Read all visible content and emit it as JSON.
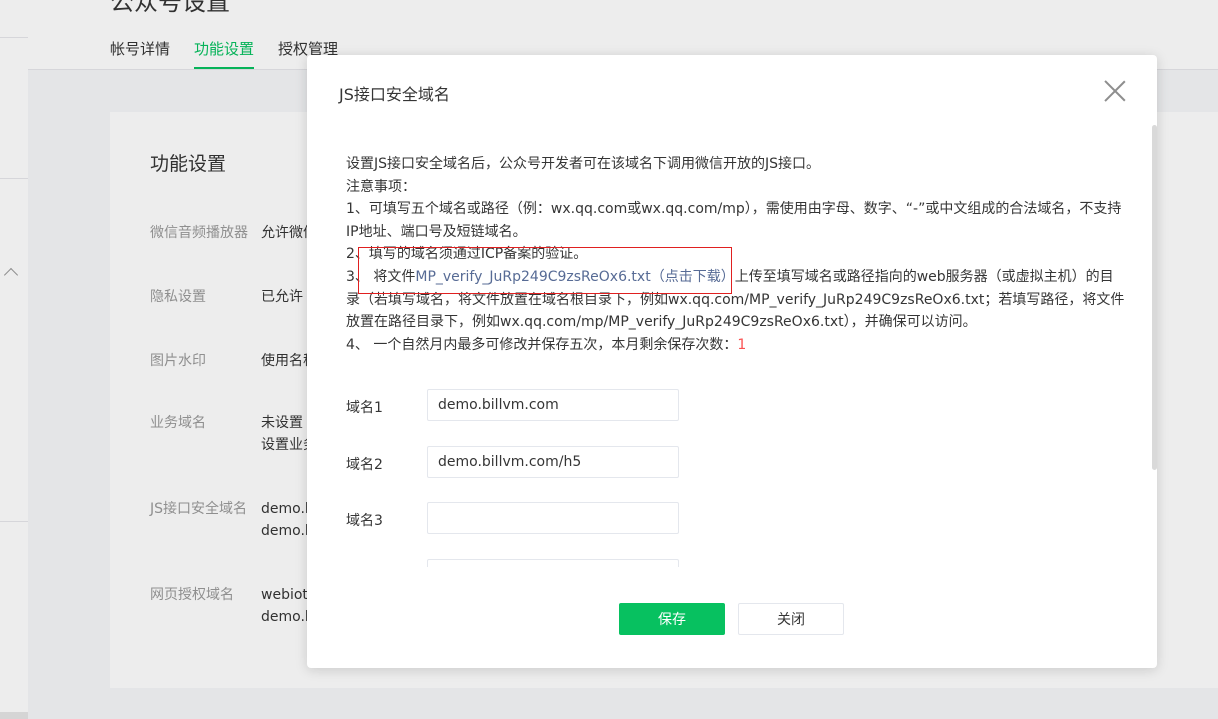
{
  "page": {
    "title": "公众号设置",
    "tabs": [
      {
        "label": "帐号详情"
      },
      {
        "label": "功能设置"
      },
      {
        "label": "授权管理"
      }
    ],
    "card_title": "功能设置",
    "settings": [
      {
        "label": "微信音频播放器",
        "value": "允许微信"
      },
      {
        "label": "隐私设置",
        "value": "已允许"
      },
      {
        "label": "图片水印",
        "value": "使用名称"
      },
      {
        "label": "业务域名",
        "value": "未设置",
        "value2": "设置业务"
      },
      {
        "label": "JS接口安全域名",
        "value": "demo.b",
        "value2": "demo.b"
      },
      {
        "label": "网页授权域名",
        "value": "webiot",
        "value2": "demo.b"
      }
    ]
  },
  "dialog": {
    "title": "JS接口安全域名",
    "intro": "设置JS接口安全域名后，公众号开发者可在该域名下调用微信开放的JS接口。",
    "notice_heading": "注意事项：",
    "note1": "1、可填写五个域名或路径（例：wx.qq.com或wx.qq.com/mp），需使用由字母、数字、“-”或中文组成的合法域名，不支持IP地址、端口号及短链域名。",
    "note2": "2、填写的域名须通过ICP备案的验证。",
    "note3_prefix": "3、 将文件",
    "note3_link": "MP_verify_JuRp249C9zsReOx6.txt（点击下载）",
    "note3_suffix": "上传至填写域名或路径指向的web服务器（或虚拟主机）的目录（若填写域名，将文件放置在域名根目录下，例如wx.qq.com/MP_verify_JuRp249C9zsReOx6.txt；若填写路径，将文件放置在路径目录下，例如wx.qq.com/mp/MP_verify_JuRp249C9zsReOx6.txt），并确保可以访问。",
    "note4_prefix": "4、 一个自然月内最多可修改并保存五次，本月剩余保存次数：",
    "note4_count": "1",
    "domains": [
      {
        "label": "域名1",
        "value": "demo.billvm.com"
      },
      {
        "label": "域名2",
        "value": "demo.billvm.com/h5"
      },
      {
        "label": "域名3",
        "value": ""
      }
    ],
    "save_label": "保存",
    "close_label": "关闭",
    "colors": {
      "primary": "#07c160",
      "link": "#576b95",
      "highlight": "#e02020",
      "count": "#fa5151"
    }
  }
}
